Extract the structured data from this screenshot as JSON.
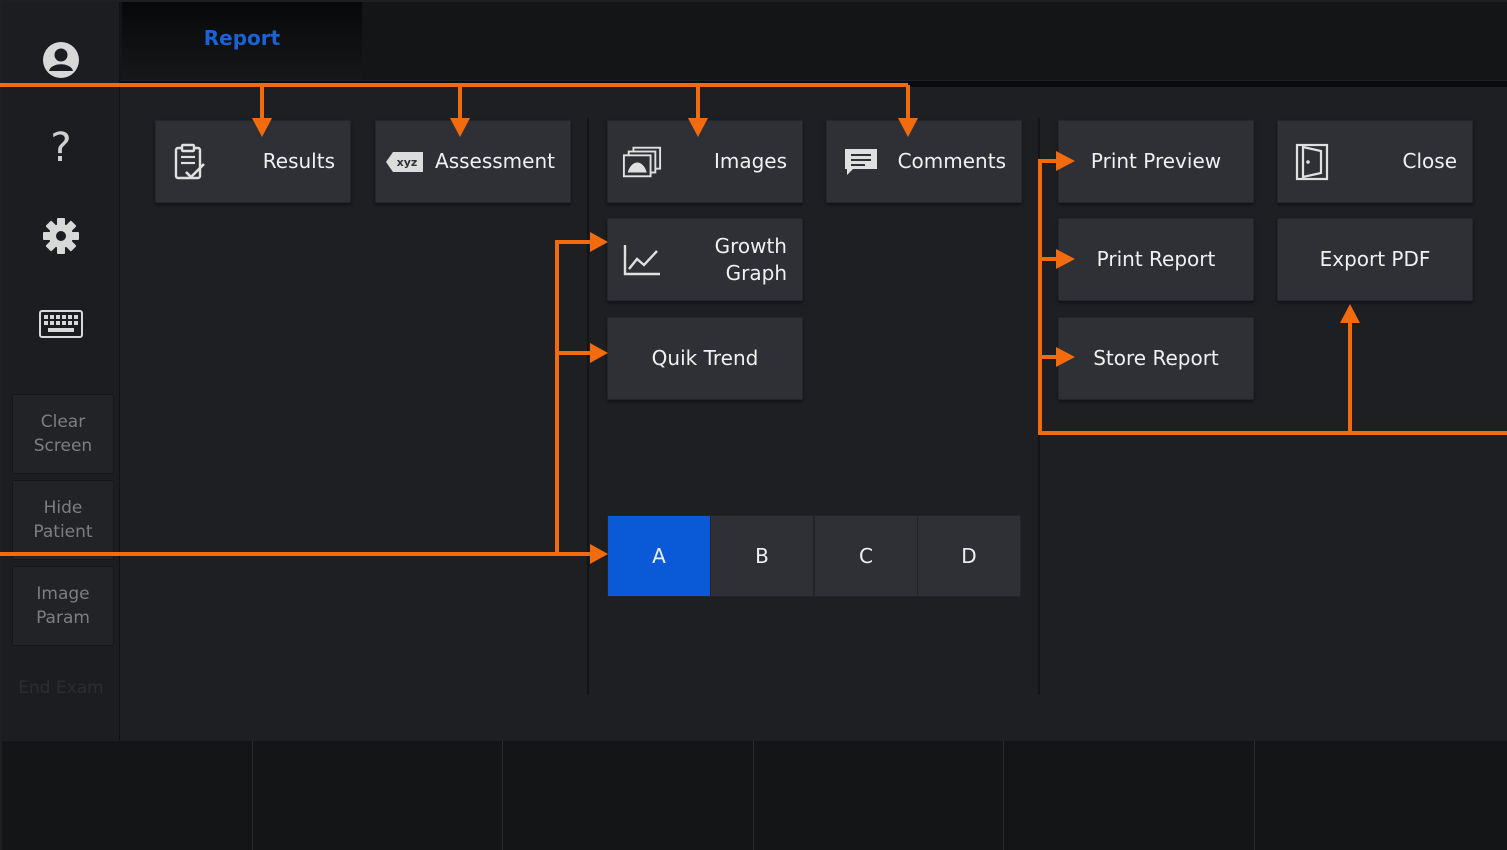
{
  "header": {
    "active_tab": "Report"
  },
  "sidebar": {
    "icons": [
      "user-icon",
      "help-icon",
      "gear-icon",
      "keyboard-icon"
    ],
    "help_glyph": "?",
    "buttons": [
      {
        "label": "Clear\nScreen"
      },
      {
        "label": "Hide\nPatient"
      },
      {
        "label": "Image\nParam"
      }
    ],
    "end_exam": "End Exam"
  },
  "panel_left": {
    "results": "Results",
    "assessment": "Assessment",
    "assessment_badge": "xyz"
  },
  "panel_middle": {
    "images": "Images",
    "comments": "Comments",
    "growth_graph": "Growth\nGraph",
    "quik_trend": "Quik Trend",
    "segments": [
      "A",
      "B",
      "C",
      "D"
    ],
    "active_segment": "A"
  },
  "panel_right": {
    "print_preview": "Print Preview",
    "close": "Close",
    "print_report": "Print Report",
    "export_pdf": "Export PDF",
    "store_report": "Store Report"
  },
  "colors": {
    "accent": "#0a59d6",
    "annotation": "#f26b0f",
    "tab_text": "#1a63d6",
    "button_bg": "#2e3035",
    "background": "#1e1f23"
  }
}
